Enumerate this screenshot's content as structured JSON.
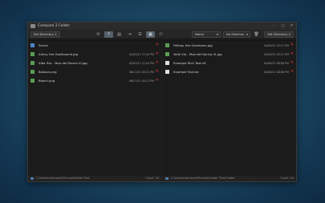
{
  "window": {
    "title": "Compare 2 Folder",
    "controls": [
      "–",
      "□",
      "✕"
    ]
  },
  "toolbar": {
    "left_button": "Set Directory 1",
    "right_button": "Set Directory 2",
    "sort_dropdown": "Name",
    "filter_dropdown": "No Matches",
    "tools": [
      {
        "name": "refresh",
        "glyph": "⟳",
        "active": false
      },
      {
        "name": "upload",
        "glyph": "⇡",
        "active": true
      },
      {
        "name": "document",
        "glyph": "▤",
        "active": false
      },
      {
        "name": "export",
        "glyph": "⇥",
        "active": false
      },
      {
        "name": "list",
        "glyph": "☰",
        "active": false
      },
      {
        "name": "grid",
        "glyph": "▦",
        "active": true
      },
      {
        "name": "user",
        "glyph": "⚇",
        "active": false
      }
    ]
  },
  "left_pane": {
    "files": [
      {
        "name": "Series",
        "date": "",
        "icon_color": "#4a86c8"
      },
      {
        "name": "Almsy Hre Goslhoome.jpg",
        "date": "02/03/21 11:04 PM",
        "icon_color": "#5a9e52"
      },
      {
        "name": "Alba Hra - Moo del Donna VI.jpg",
        "date": "02/03/21 11:04 PM",
        "icon_color": "#5a9e52"
      },
      {
        "name": "Balloon.png",
        "date": "06/21/21 05:21 PM",
        "icon_color": "#5a9e52"
      },
      {
        "name": "Beach.png",
        "date": "06/21/21 05:21 PM",
        "icon_color": "#5a9e52"
      }
    ],
    "path": "C:\\Users\\username\\Pictures\\Folder First",
    "count": "Count: 50"
  },
  "right_pane": {
    "files": [
      {
        "name": "Hiltnay Hre Goslhoom.jpg",
        "date": "04/05/22 05:21 PM",
        "icon_color": "#5a9e52"
      },
      {
        "name": "Valle Via - Moo del Donna VI.jpg",
        "date": "04/05/22 05:21 PM",
        "icon_color": "#5a9e52"
      },
      {
        "name": "Example Rich Text.rtf",
        "date": "04/06/22 08:08 PM",
        "icon_color": "#e0e0e0"
      },
      {
        "name": "Example Text.txt",
        "date": "04/06/22 08:08 PM",
        "icon_color": "#e0e0e0"
      }
    ],
    "path": "C:\\Users\\username\\Pictures\\Folder Third Folder",
    "count": "Count: 50"
  },
  "colors": {
    "delete": "#d83a3a",
    "accent": "#55616b"
  }
}
